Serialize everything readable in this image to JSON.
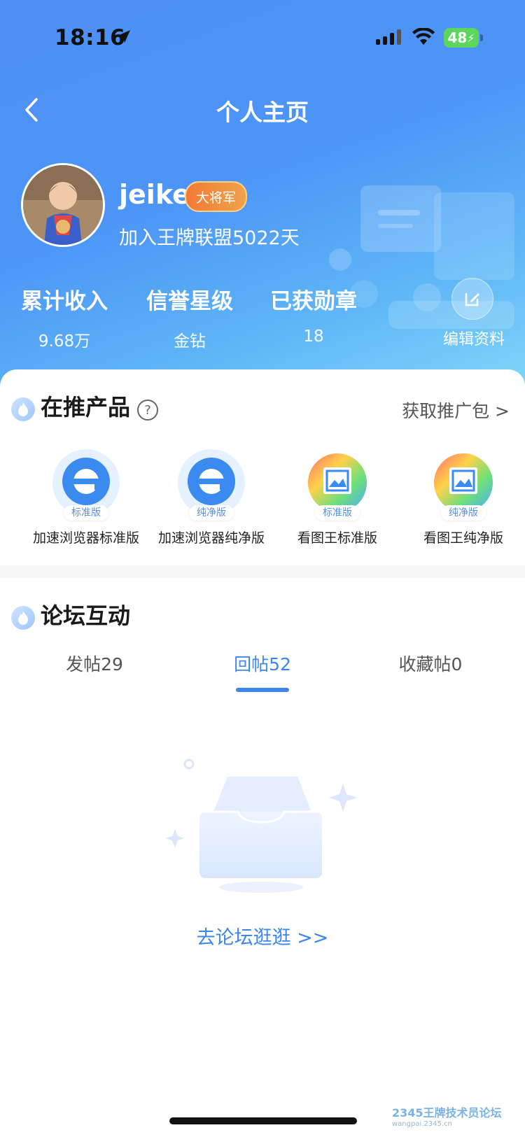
{
  "status_bar": {
    "time": "18:16",
    "battery": "48"
  },
  "nav": {
    "title": "个人主页"
  },
  "profile": {
    "username": "jeike",
    "rank_badge": "大将军",
    "joined_text": "加入王牌联盟5022天"
  },
  "stats": [
    {
      "label": "累计收入",
      "value": "9.68万"
    },
    {
      "label": "信誉星级",
      "value": "金钻"
    },
    {
      "label": "已获勋章",
      "value": "18"
    }
  ],
  "edit_profile_label": "编辑资料",
  "products_section": {
    "title": "在推产品",
    "more_link": "获取推广包 >",
    "items": [
      {
        "name": "加速浏览器标准版",
        "tag": "标准版",
        "icon": "browser-e-icon"
      },
      {
        "name": "加速浏览器纯净版",
        "tag": "纯净版",
        "icon": "browser-e-icon"
      },
      {
        "name": "看图王标准版",
        "tag": "标准版",
        "icon": "image-viewer-icon"
      },
      {
        "name": "看图王纯净版",
        "tag": "纯净版",
        "icon": "image-viewer-icon"
      }
    ]
  },
  "forum_section": {
    "title": "论坛互动",
    "tabs": [
      {
        "label": "发帖29",
        "active": false
      },
      {
        "label": "回帖52",
        "active": true
      },
      {
        "label": "收藏帖0",
        "active": false
      }
    ],
    "empty_link": "去论坛逛逛 >>"
  },
  "watermark": {
    "text": "2345王牌技术员论坛",
    "sub": "wangpai.2345.cn"
  },
  "colors": {
    "header_blue": "#4f8ff5",
    "accent": "#3c86ee",
    "badge_orange": "#f17a35"
  }
}
